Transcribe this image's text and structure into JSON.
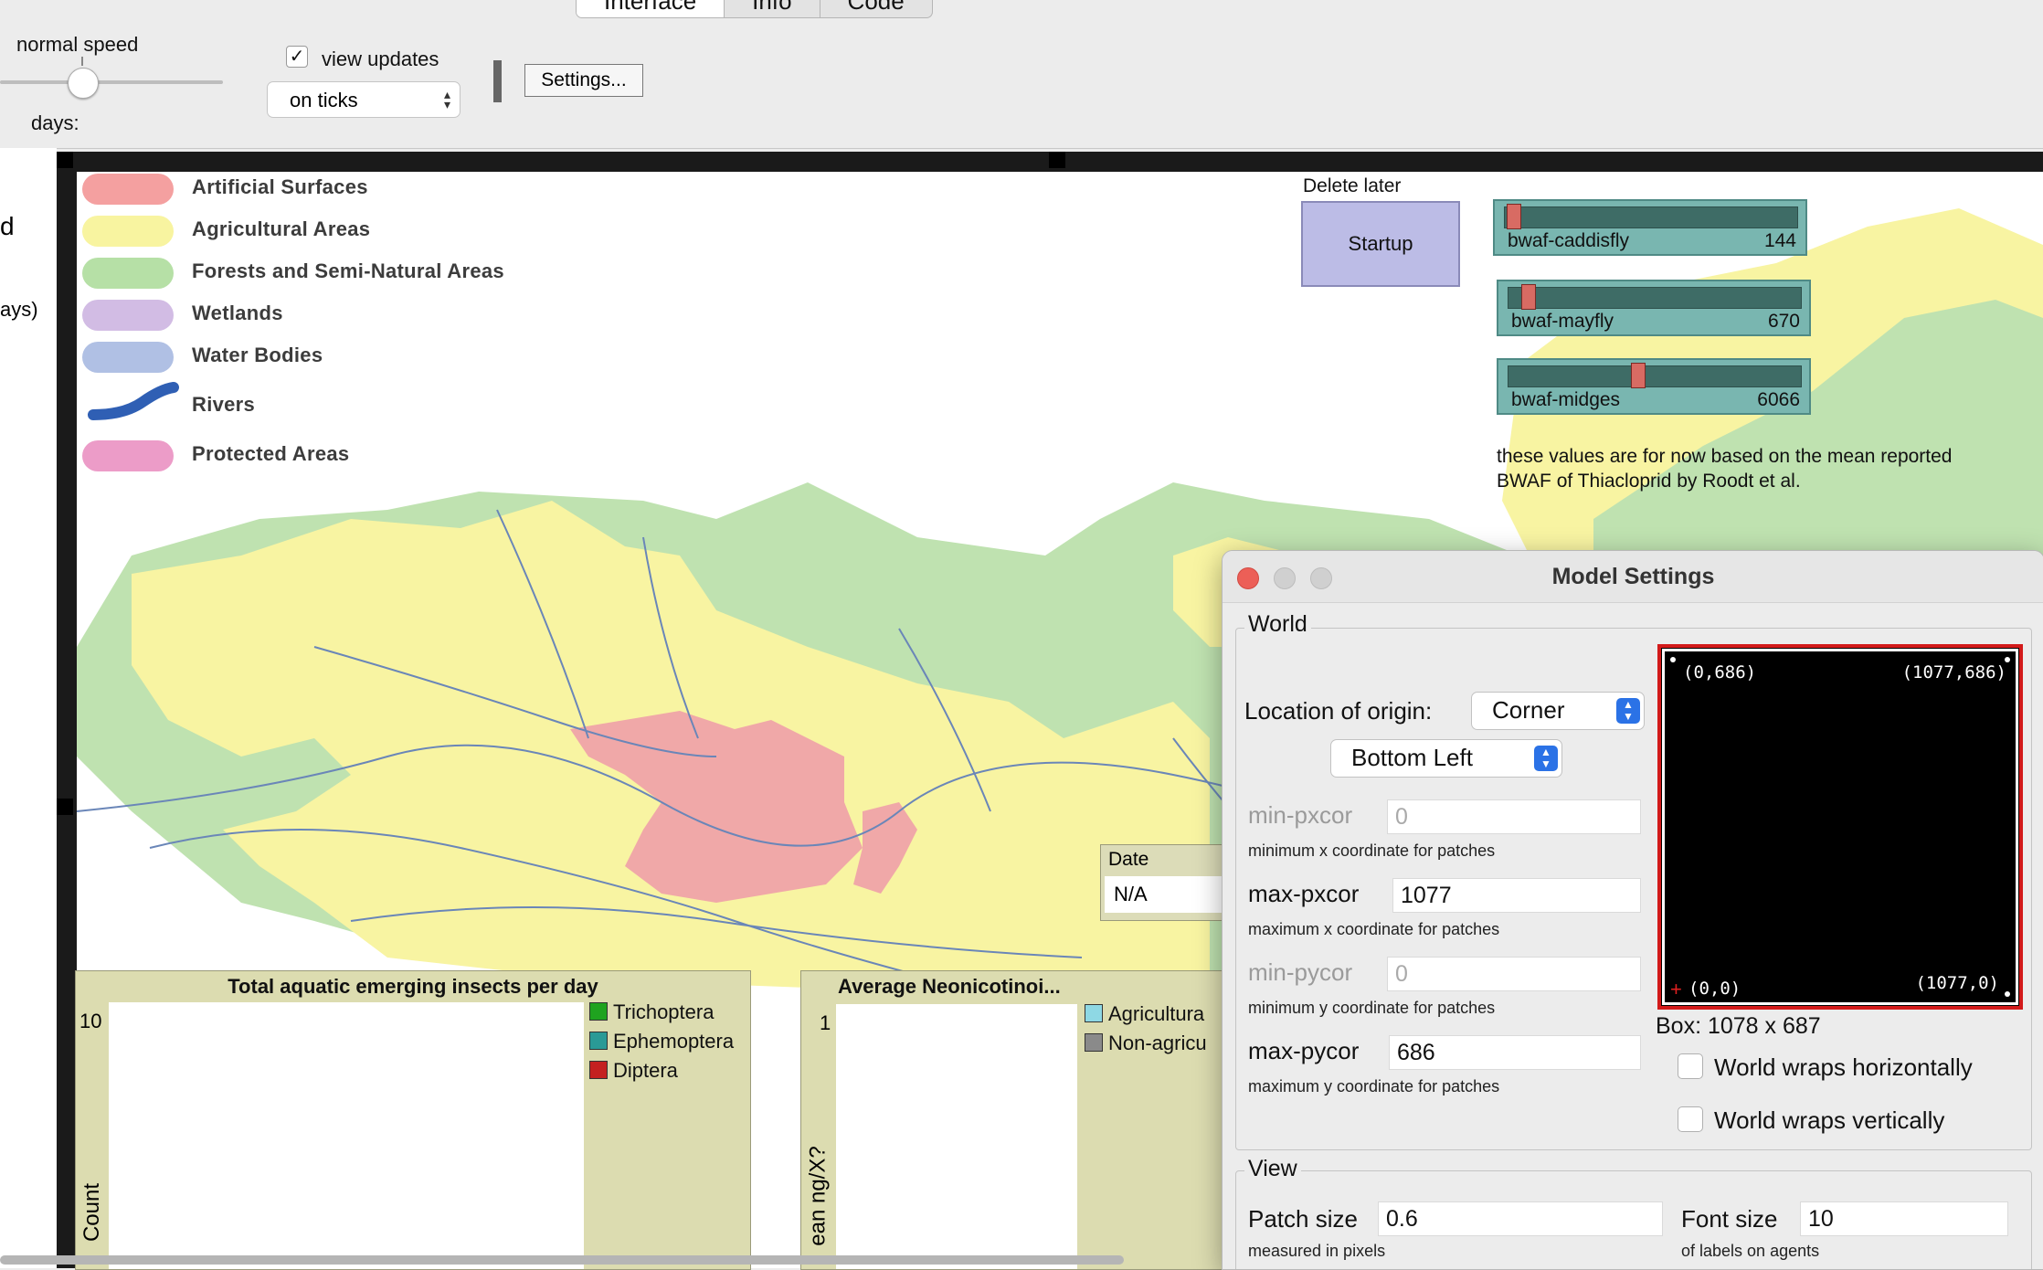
{
  "tabs": [
    "Interface",
    "Info",
    "Code"
  ],
  "toolbar": {
    "speed_label": "normal speed",
    "view_updates_label": "view updates",
    "view_updates_checked": "✓",
    "update_mode": "on ticks",
    "settings_label": "Settings...",
    "ticks_label": "days:"
  },
  "left_fragments": [
    "d",
    "ays)"
  ],
  "legend": [
    {
      "label": "Artificial Surfaces",
      "color": "#f4a0a0"
    },
    {
      "label": "Agricultural Areas",
      "color": "#f8f4a0"
    },
    {
      "label": "Forests and Semi-Natural Areas",
      "color": "#b6e0a6"
    },
    {
      "label": "Wetlands",
      "color": "#d2bce4"
    },
    {
      "label": "Water Bodies",
      "color": "#b0c0e4"
    },
    {
      "label": "Rivers",
      "color": "#2f5fb4"
    },
    {
      "label": "Protected Areas",
      "color": "#ec9cc8"
    }
  ],
  "buttons": {
    "delete_label": "Delete later",
    "startup_label": "Startup"
  },
  "sliders": [
    {
      "name": "bwaf-caddisfly",
      "value": "144",
      "fraction": 0.01
    },
    {
      "name": "bwaf-mayfly",
      "value": "670",
      "fraction": 0.05
    },
    {
      "name": "bwaf-midges",
      "value": "6066",
      "fraction": 0.44
    }
  ],
  "note": "these values are for now based on the mean reported BWAF of Thiacloprid by Roodt et al.",
  "monitor": {
    "label": "Date",
    "value": "N/A"
  },
  "plots": {
    "insects": {
      "title": "Total aquatic emerging insects per day",
      "ymax": "10",
      "ylabel": "Count",
      "legend": [
        {
          "label": "Trichoptera",
          "color": "#1fa31f"
        },
        {
          "label": "Ephemoptera",
          "color": "#2a9a96"
        },
        {
          "label": "Diptera",
          "color": "#c42020"
        }
      ]
    },
    "neonic": {
      "title": "Average Neonicotinoi...",
      "ymax": "1",
      "ylabel": "ean ng/X?",
      "legend": [
        {
          "label": "Agricultura",
          "color": "#8ed8e4"
        },
        {
          "label": "Non-agricu",
          "color": "#8a8a8a"
        }
      ]
    }
  },
  "dialog": {
    "title": "Model Settings",
    "world_label": "World",
    "origin_label": "Location of origin:",
    "origin_value": "Corner",
    "corner_value": "Bottom Left",
    "fields": [
      {
        "label": "min-pxcor",
        "value": "0",
        "hint": "minimum x coordinate for patches",
        "disabled": true
      },
      {
        "label": "max-pxcor",
        "value": "1077",
        "hint": "maximum x coordinate for patches",
        "disabled": false
      },
      {
        "label": "min-pycor",
        "value": "0",
        "hint": "minimum y coordinate for patches",
        "disabled": true
      },
      {
        "label": "max-pycor",
        "value": "686",
        "hint": "maximum y coordinate for patches",
        "disabled": false
      }
    ],
    "corners": {
      "tl": "(0,686)",
      "tr": "(1077,686)",
      "bl": "(0,0)",
      "br": "(1077,0)"
    },
    "box_label": "Box: 1078 x 687",
    "wrap_h": "World wraps horizontally",
    "wrap_v": "World wraps vertically",
    "view_label": "View",
    "patch_size_label": "Patch size",
    "patch_size_value": "0.6",
    "patch_size_hint": "measured in pixels",
    "font_size_label": "Font size",
    "font_size_value": "10",
    "font_size_hint": "of labels on agents"
  }
}
